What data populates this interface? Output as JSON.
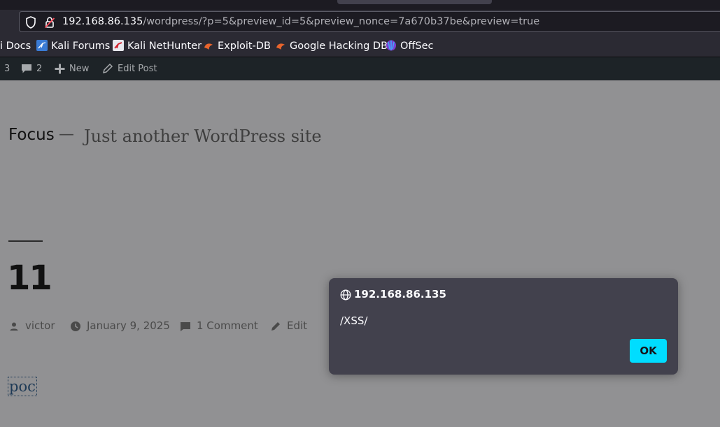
{
  "browser": {
    "url_host": "192.168.86.135",
    "url_path": "/wordpress/?p=5&preview_id=5&preview_nonce=7a670b37be&preview=true"
  },
  "bookmarks": [
    {
      "label": "i Docs",
      "icon": "kali-docs-icon"
    },
    {
      "label": "Kali Forums",
      "icon": "kali-forums-icon"
    },
    {
      "label": "Kali NetHunter",
      "icon": "kali-nethunter-icon"
    },
    {
      "label": "Exploit-DB",
      "icon": "exploit-db-icon"
    },
    {
      "label": "Google Hacking DB",
      "icon": "google-hacking-db-icon"
    },
    {
      "label": "OffSec",
      "icon": "offsec-icon"
    }
  ],
  "admin_bar": {
    "updates_count": "3",
    "comments_count": "2",
    "new_label": "New",
    "edit_post_label": "Edit Post"
  },
  "site": {
    "title": "Focus",
    "separator": "—",
    "description": "Just another WordPress site"
  },
  "post": {
    "title": "11",
    "author": "victor",
    "date": "January 9, 2025",
    "comments": "1 Comment",
    "edit": "Edit",
    "content": "poc"
  },
  "dialog": {
    "origin": "192.168.86.135",
    "message": "/XSS/",
    "ok_label": "OK"
  },
  "colors": {
    "accent_button": "#00ddff",
    "dialog_bg": "#42414d",
    "admin_bar_bg": "#1d2327",
    "page_bg": "#919193"
  }
}
